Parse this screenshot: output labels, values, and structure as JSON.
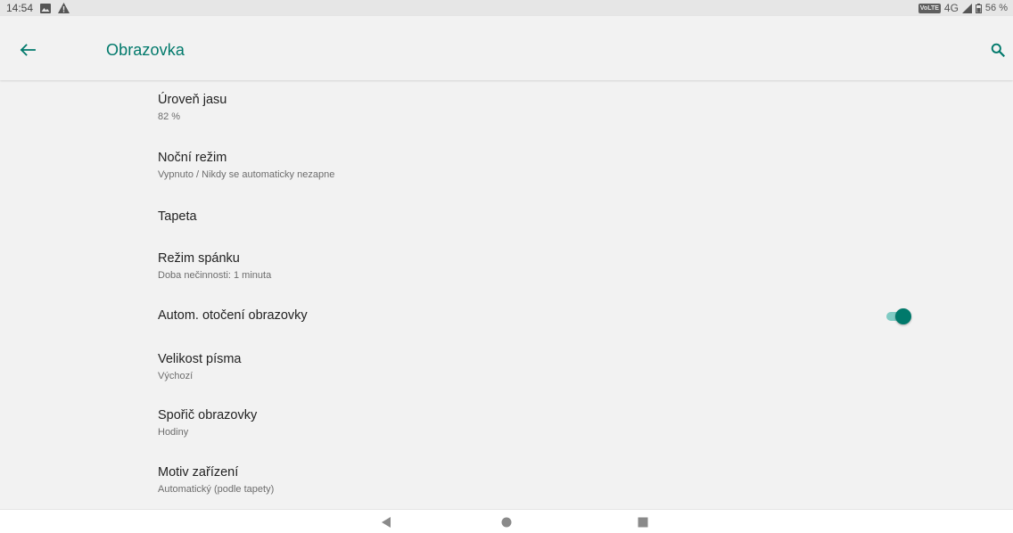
{
  "status_bar": {
    "time": "14:54",
    "volte": "VoLTE",
    "network": "4G",
    "battery": "56 %"
  },
  "app_bar": {
    "title": "Obrazovka",
    "accent_color": "#00796b"
  },
  "items": [
    {
      "title": "Úroveň jasu",
      "summary": "82 %"
    },
    {
      "title": "Noční režim",
      "summary": "Vypnuto / Nikdy se automaticky nezapne"
    },
    {
      "title": "Tapeta",
      "summary": ""
    },
    {
      "title": "Režim spánku",
      "summary": "Doba nečinnosti: 1 minuta"
    },
    {
      "title": "Autom. otočení obrazovky",
      "summary": "",
      "toggle_on": true
    },
    {
      "title": "Velikost písma",
      "summary": "Výchozí"
    },
    {
      "title": "Spořič obrazovky",
      "summary": "Hodiny"
    },
    {
      "title": "Motiv zařízení",
      "summary": "Automatický (podle tapety)"
    }
  ],
  "icons": {
    "back": "arrow-left-icon",
    "search": "search-icon",
    "nav_back": "triangle-back-icon",
    "nav_home": "circle-home-icon",
    "nav_recent": "square-recent-icon"
  }
}
